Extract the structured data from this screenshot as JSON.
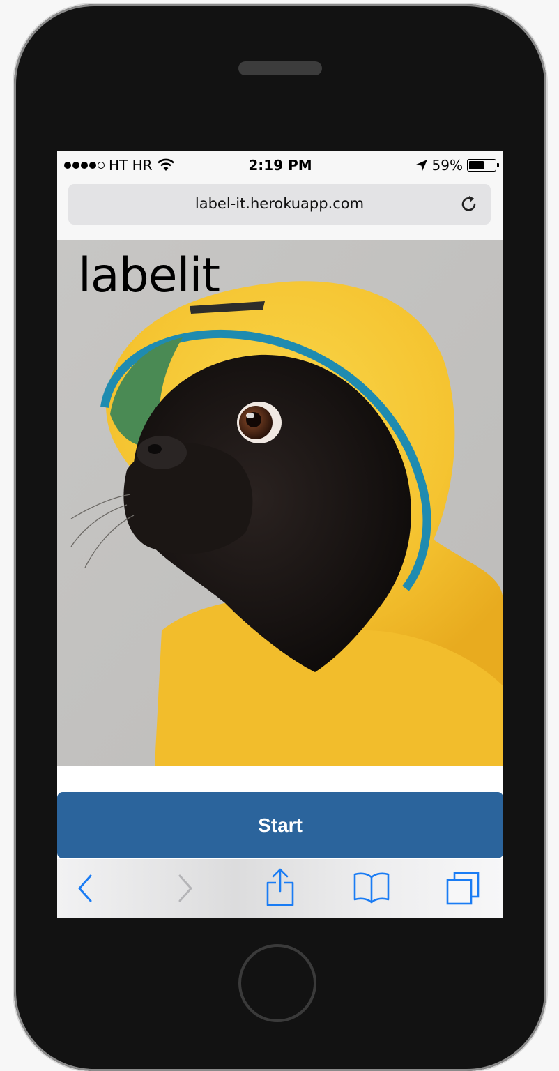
{
  "status_bar": {
    "carrier": "HT HR",
    "time": "2:19 PM",
    "battery": "59%",
    "battery_level": 0.59,
    "signal_bars_filled": 4,
    "signal_bars_total": 5
  },
  "browser": {
    "url": "label-it.herokuapp.com"
  },
  "app": {
    "brand": "labelit",
    "start_label": "Start",
    "accent_color": "#2b649c"
  },
  "toolbar": {
    "icons": [
      "back-icon",
      "forward-icon",
      "share-icon",
      "bookmarks-icon",
      "tabs-icon"
    ],
    "ios_blue": "#1a7cf4"
  }
}
